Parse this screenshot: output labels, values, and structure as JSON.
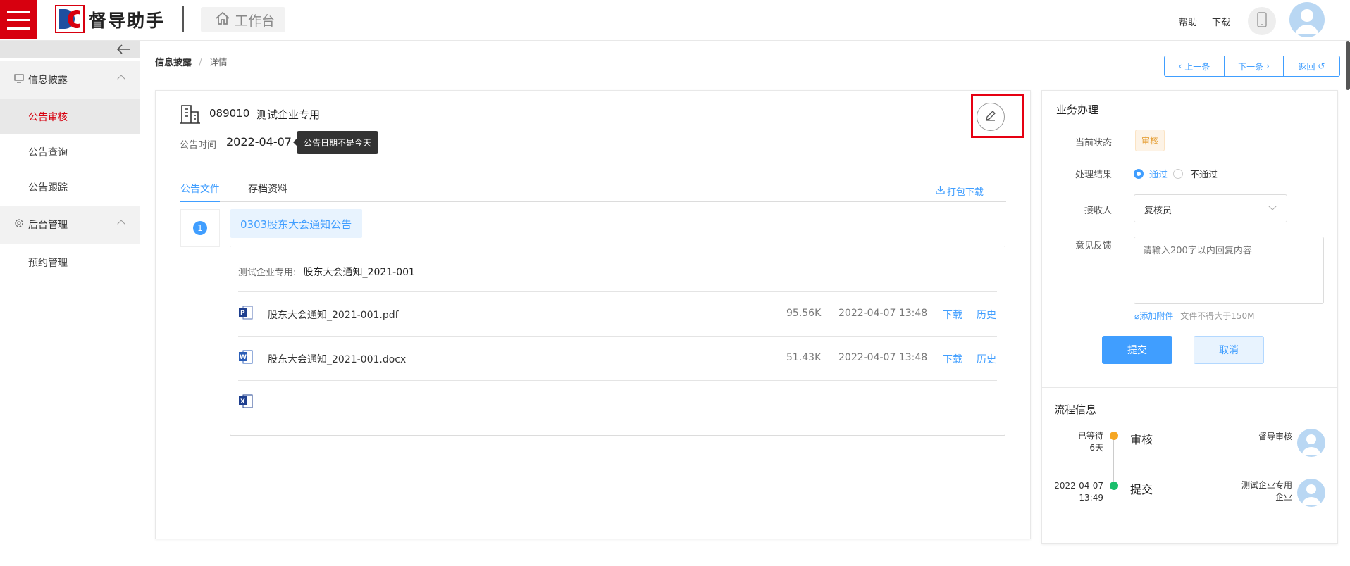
{
  "header": {
    "brand": "督导助手",
    "workspace_label": "工作台",
    "help_label": "帮助",
    "download_label": "下载",
    "accent_color": "#d7000f"
  },
  "sidebar": {
    "groups": [
      {
        "label": "信息披露",
        "icon": "monitor-icon",
        "items": [
          {
            "label": "公告审核",
            "active": true
          },
          {
            "label": "公告查询"
          },
          {
            "label": "公告跟踪"
          }
        ]
      },
      {
        "label": "后台管理",
        "icon": "gear-icon",
        "items": [
          {
            "label": "预约管理"
          }
        ]
      }
    ]
  },
  "breadcrumb": {
    "parent": "信息披露",
    "sep": "/",
    "current": "详情"
  },
  "nav": {
    "prev": "上一条",
    "next": "下一条",
    "back": "返回"
  },
  "announcement": {
    "code": "089010",
    "company": "测试企业专用",
    "date_label": "公告时间",
    "date": "2022-04-07",
    "tooltip": "公告日期不是今天",
    "tabs": [
      {
        "label": "公告文件",
        "active": true
      },
      {
        "label": "存档资料"
      }
    ],
    "pack_download": "打包下载",
    "step_number": "1",
    "title_chip": "0303股东大会通知公告",
    "doc_prefix": "测试企业专用:",
    "doc_name": "股东大会通知_2021-001",
    "files": [
      {
        "icon": "pdf-file-icon",
        "name": "股东大会通知_2021-001.pdf",
        "size": "95.56K",
        "time": "2022-04-07 13:48",
        "download": "下载",
        "history": "历史"
      },
      {
        "icon": "word-file-icon",
        "name": "股东大会通知_2021-001.docx",
        "size": "51.43K",
        "time": "2022-04-07 13:48",
        "download": "下载",
        "history": "历史"
      },
      {
        "icon": "excel-file-icon",
        "name": "",
        "size": "",
        "time": "",
        "download": "",
        "history": ""
      }
    ]
  },
  "business": {
    "title": "业务办理",
    "status_label": "当前状态",
    "status_value": "审核",
    "result_label": "处理结果",
    "result_options": [
      "通过",
      "不通过"
    ],
    "receiver_label": "接收人",
    "receiver_value": "复核员",
    "feedback_label": "意见反馈",
    "feedback_placeholder": "请输入200字以内回复内容",
    "attach_label": "添加附件",
    "attach_hint": "文件不得大于150M",
    "submit": "提交",
    "cancel": "取消"
  },
  "process": {
    "title": "流程信息",
    "steps": [
      {
        "time_line1": "已等待",
        "time_line2": "6天",
        "name": "审核",
        "user_line1": "督导审核",
        "user_line2": "",
        "dot_color": "#f5a623"
      },
      {
        "time_line1": "2022-04-07",
        "time_line2": "13:49",
        "name": "提交",
        "user_line1": "测试企业专用",
        "user_line2": "企业",
        "dot_color": "#19be6b"
      }
    ]
  }
}
